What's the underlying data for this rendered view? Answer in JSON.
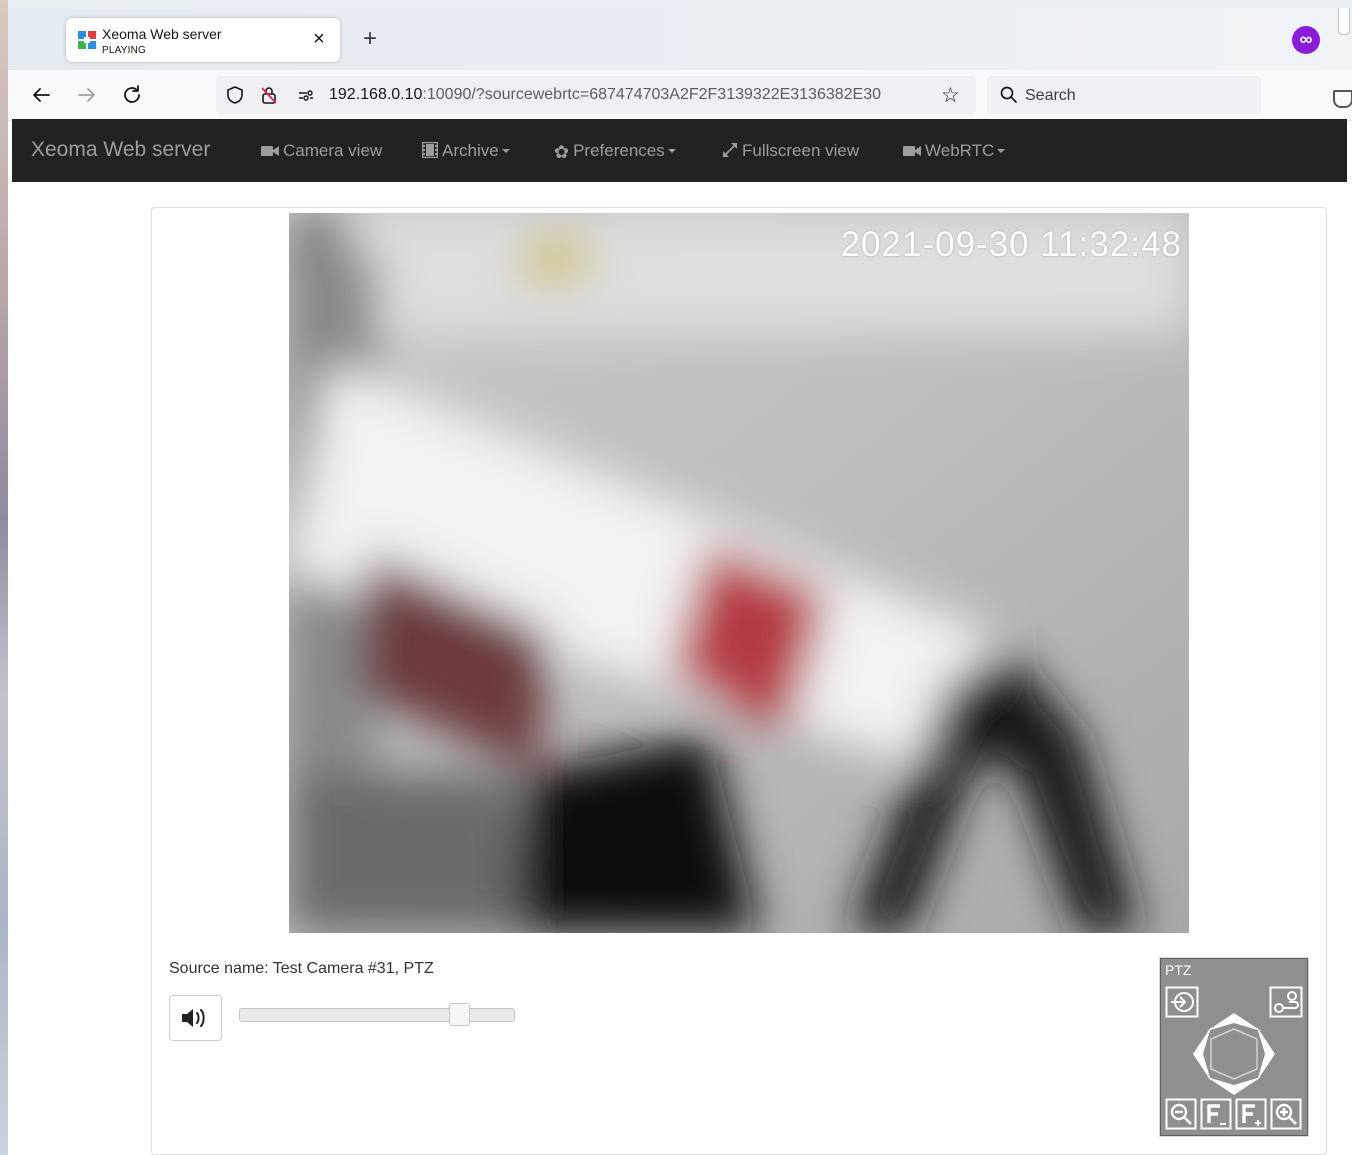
{
  "browser": {
    "tab": {
      "title": "Xeoma Web server",
      "subtitle": "PLAYING",
      "close": "×"
    },
    "new_tab": "+",
    "url": {
      "host": "192.168.0.10",
      "rest": ":10090/?sourcewebrtc=687474703A2F2F3139322E3136382E30"
    },
    "search_placeholder": "Search"
  },
  "app": {
    "brand": "Xeoma Web server",
    "menu": {
      "camera_view": "Camera view",
      "archive": "Archive",
      "preferences": "Preferences",
      "fullscreen": "Fullscreen view",
      "webrtc": "WebRTC"
    }
  },
  "player": {
    "timestamp": "2021-09-30  11:32:48",
    "source_name": "Source name: Test Camera #31, PTZ",
    "volume_level": 0.8
  },
  "ptz": {
    "label": "PTZ"
  },
  "colors": {
    "app_navbar_bg": "#222222",
    "app_navbar_text": "#9d9d9d",
    "ptz_bg": "#8f8f8f",
    "extension_purple": "#8a1bd8"
  },
  "icons": [
    "xeoma-favicon",
    "close-icon",
    "plus-icon",
    "extension-icon",
    "back-icon",
    "forward-icon",
    "reload-icon",
    "shield-icon",
    "lock-crossed-icon",
    "permissions-icon",
    "bookmark-star-icon",
    "search-icon",
    "pocket-icon",
    "video-camera-icon",
    "film-icon",
    "gear-icon",
    "expand-icon",
    "volume-icon",
    "ptz-enter-icon",
    "ptz-settings-icon",
    "ptz-arrows",
    "zoom-out-icon",
    "focus-minus-icon",
    "focus-plus-icon",
    "zoom-in-icon"
  ]
}
